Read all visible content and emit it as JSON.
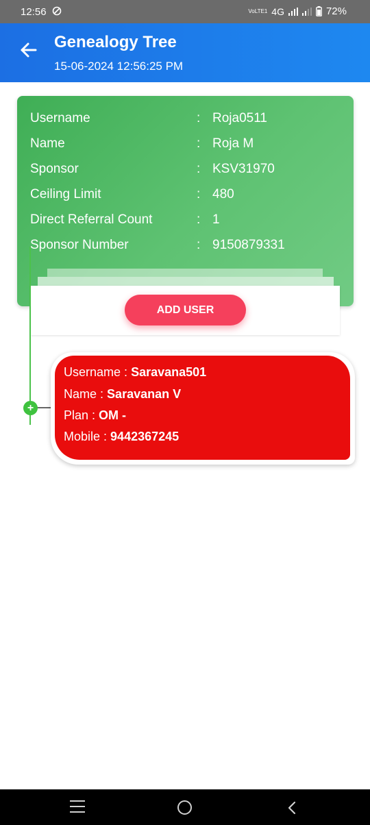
{
  "status_bar": {
    "time": "12:56",
    "network": "4G",
    "volte": "VoLTE1",
    "battery": "72%"
  },
  "app_bar": {
    "title": "Genealogy Tree",
    "subtitle": "15-06-2024 12:56:25 PM"
  },
  "info_card": {
    "colon": ":",
    "rows": [
      {
        "label": "Username",
        "value": "Roja0511"
      },
      {
        "label": "Name",
        "value": "Roja M"
      },
      {
        "label": "Sponsor",
        "value": "KSV31970"
      },
      {
        "label": "Ceiling Limit",
        "value": "480"
      },
      {
        "label": "Direct Referral Count",
        "value": "1"
      },
      {
        "label": "Sponsor Number",
        "value": "9150879331"
      }
    ],
    "add_user_label": "ADD USER"
  },
  "tree": {
    "expand_symbol": "+",
    "member": {
      "username_label": "Username :",
      "username": "Saravana501",
      "name_label": "Name :",
      "name": "Saravanan V",
      "plan_label": "Plan :",
      "plan": "OM -",
      "mobile_label": "Mobile :",
      "mobile": "9442367245"
    }
  },
  "colors": {
    "app_bar": "#1e7fe9",
    "info_card": "#55bb69",
    "add_user_button": "#f5405c",
    "member_card": "#e90d0d",
    "tree_line": "#4bc24b"
  }
}
